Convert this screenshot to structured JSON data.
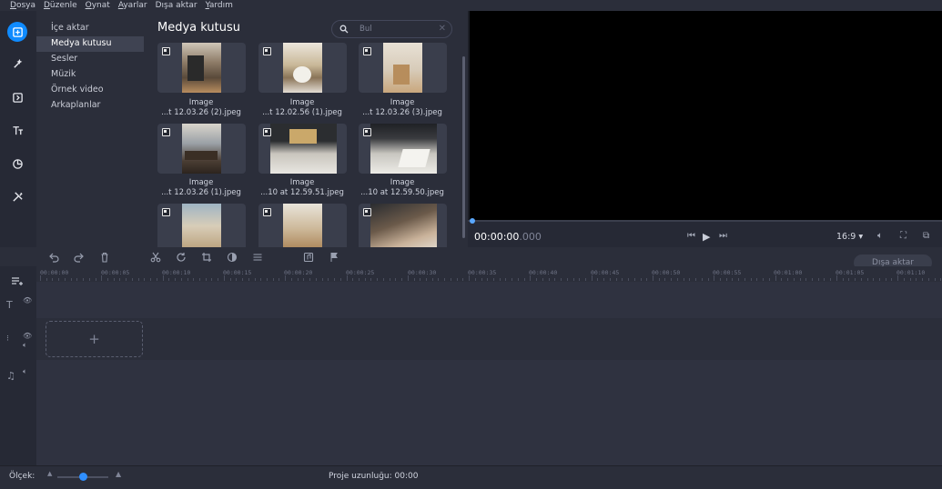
{
  "menu": [
    {
      "label": "Dosya",
      "u": "D",
      "rest": "osya"
    },
    {
      "label": "Düzenle",
      "u": "D",
      "rest": "üzenle"
    },
    {
      "label": "Oynat",
      "u": "O",
      "rest": "ynat"
    },
    {
      "label": "Ayarlar",
      "u": "A",
      "rest": "yarlar"
    },
    {
      "label": "Dışa aktar",
      "u": "",
      "rest": "Dışa aktar"
    },
    {
      "label": "Yardım",
      "u": "Y",
      "rest": "ardım"
    }
  ],
  "categories": [
    "İçe aktar",
    "Medya kutusu",
    "Sesler",
    "Müzik",
    "Örnek video",
    "Arkaplanlar"
  ],
  "media": {
    "title": "Medya kutusu",
    "search_placeholder": "Bul",
    "items": [
      {
        "line1": "Image",
        "line2": "...t 12.03.26 (2).jpeg"
      },
      {
        "line1": "Image",
        "line2": "...t 12.02.56 (1).jpeg"
      },
      {
        "line1": "Image",
        "line2": "...t 12.03.26 (3).jpeg"
      },
      {
        "line1": "Image",
        "line2": "...t 12.03.26 (1).jpeg"
      },
      {
        "line1": "Image",
        "line2": "...10 at 12.59.51.jpeg"
      },
      {
        "line1": "Image",
        "line2": "...10 at 12.59.50.jpeg"
      }
    ]
  },
  "player": {
    "timecode_main": "00:00:00",
    "timecode_ms": ".000",
    "aspect": "16:9 ▾"
  },
  "timeline": {
    "export_label": "Dışa aktar",
    "ruler": [
      "00:00:00",
      "00:00:05",
      "00:00:10",
      "00:00:15",
      "00:00:20",
      "00:00:25",
      "00:00:30",
      "00:00:35",
      "00:00:40",
      "00:00:45",
      "00:00:50",
      "00:00:55",
      "00:01:00",
      "00:01:05",
      "00:01:10"
    ]
  },
  "status": {
    "scale_label": "Ölçek:",
    "project_length": "Proje uzunluğu: 00:00",
    "zoom_level": 0.5
  }
}
